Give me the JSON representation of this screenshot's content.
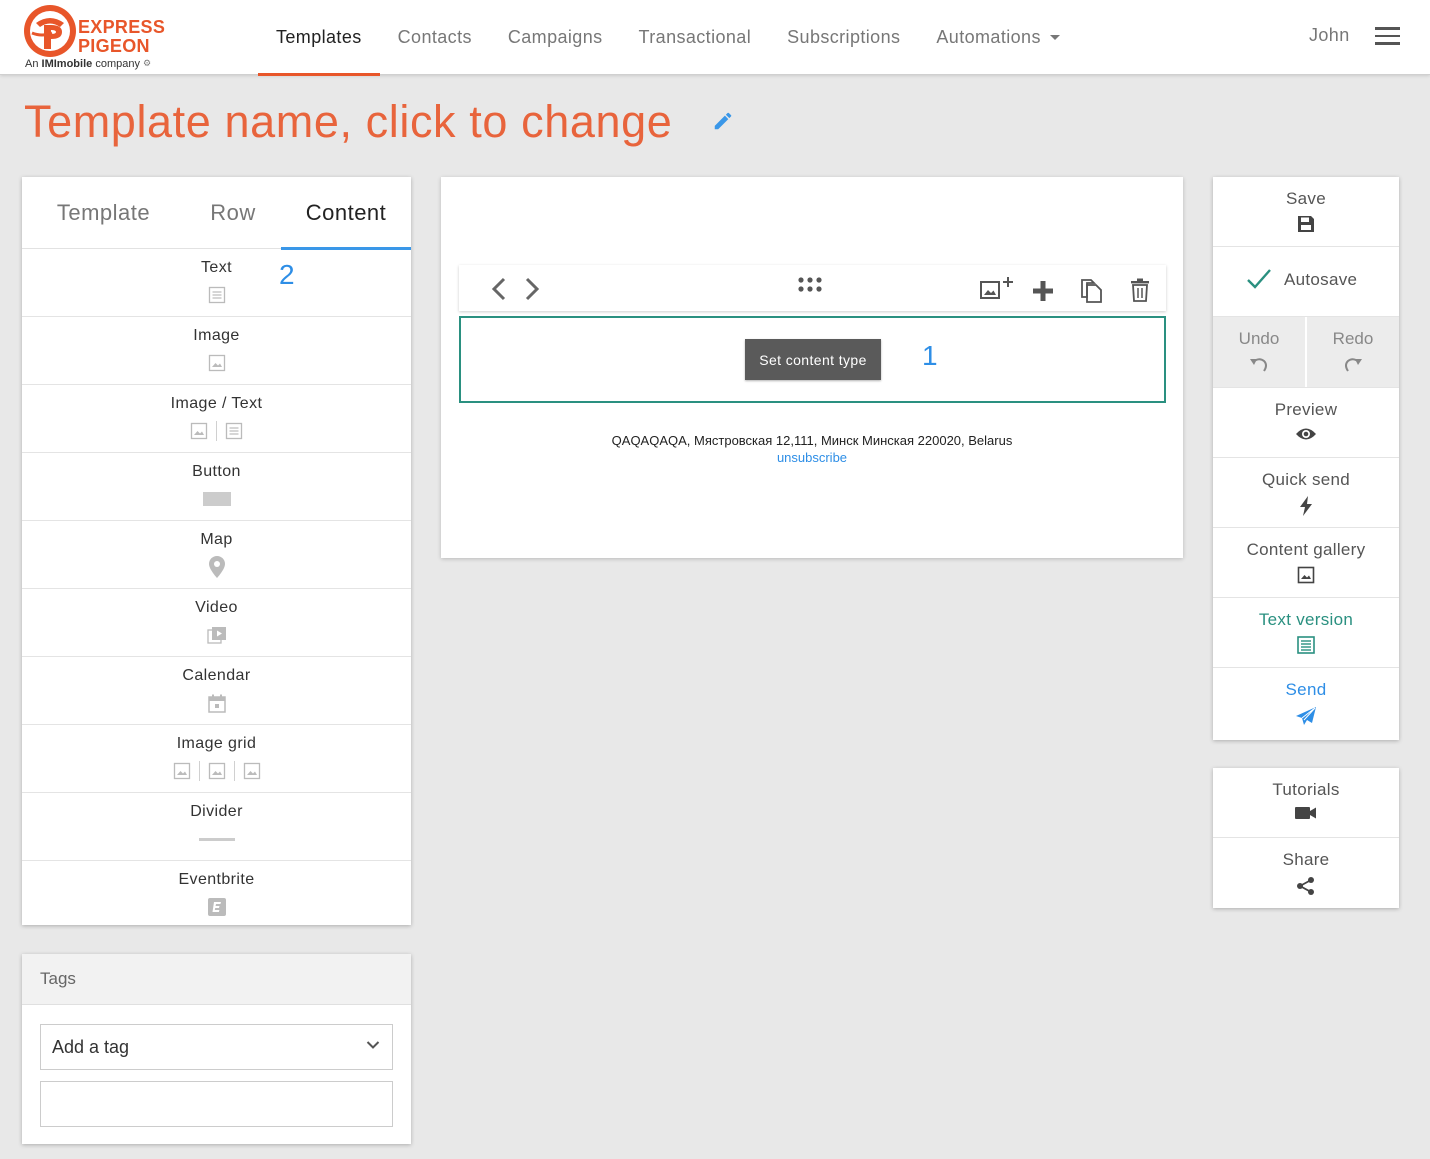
{
  "brand": {
    "line1": "EXPRESS",
    "line2": "PIGEON",
    "sub_prefix": "An",
    "sub_bold": "IMImobile",
    "sub_suffix": "company",
    "color": "#e8562a"
  },
  "nav": {
    "items": [
      {
        "label": "Templates",
        "active": true
      },
      {
        "label": "Contacts"
      },
      {
        "label": "Campaigns"
      },
      {
        "label": "Transactional"
      },
      {
        "label": "Subscriptions"
      },
      {
        "label": "Automations",
        "has_dropdown": true
      }
    ],
    "user": "John",
    "menu_icon": "hamburger-icon"
  },
  "title": "Template name, click to change",
  "left_panel": {
    "tabs": [
      "Template",
      "Row",
      "Content"
    ],
    "active_tab": "Content",
    "items": [
      {
        "label": "Text",
        "icon": "text-icon"
      },
      {
        "label": "Image",
        "icon": "image-icon"
      },
      {
        "label": "Image / Text",
        "icon": "image-text-icon"
      },
      {
        "label": "Button",
        "icon": "button-icon"
      },
      {
        "label": "Map",
        "icon": "map-pin-icon"
      },
      {
        "label": "Video",
        "icon": "video-icon"
      },
      {
        "label": "Calendar",
        "icon": "calendar-icon"
      },
      {
        "label": "Image grid",
        "icon": "image-grid-icon"
      },
      {
        "label": "Divider",
        "icon": "divider-icon"
      },
      {
        "label": "Eventbrite",
        "icon": "eventbrite-icon"
      }
    ],
    "marker": "2"
  },
  "tags": {
    "header": "Tags",
    "select_value": "Add a tag",
    "input_value": ""
  },
  "canvas": {
    "set_content_label": "Set content type",
    "marker": "1",
    "footer_address": "QAQAQAQA, Мястровская 12,111, Минск Минская 220020, Belarus",
    "footer_link": "unsubscribe",
    "row_border_color": "#2a9080"
  },
  "right_panel": {
    "save": "Save",
    "autosave": "Autosave",
    "undo": "Undo",
    "redo": "Redo",
    "preview": "Preview",
    "quick_send": "Quick send",
    "content_gallery": "Content gallery",
    "text_version": "Text version",
    "send": "Send",
    "tutorials": "Tutorials",
    "share": "Share"
  },
  "colors": {
    "accent": "#e8643c",
    "link_blue": "#2e8ee6",
    "teal": "#2a9080",
    "active_tab_underline": "#3a97e8"
  }
}
